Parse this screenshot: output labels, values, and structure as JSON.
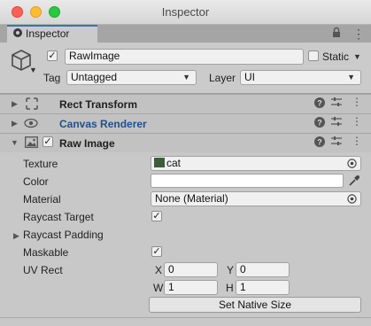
{
  "window": {
    "title": "Inspector"
  },
  "tab": {
    "label": "Inspector"
  },
  "gameobject": {
    "name": "RawImage",
    "static_label": "Static",
    "tag_label": "Tag",
    "tag_value": "Untagged",
    "layer_label": "Layer",
    "layer_value": "UI"
  },
  "components": [
    {
      "title": "Rect Transform"
    },
    {
      "title": "Canvas Renderer"
    },
    {
      "title": "Raw Image"
    }
  ],
  "raw_image": {
    "texture_label": "Texture",
    "texture_value": "cat",
    "color_label": "Color",
    "material_label": "Material",
    "material_value": "None (Material)",
    "raycast_target_label": "Raycast Target",
    "raycast_padding_label": "Raycast Padding",
    "maskable_label": "Maskable",
    "uv_rect_label": "UV Rect",
    "uv": {
      "x_label": "X",
      "x_value": "0",
      "y_label": "Y",
      "y_value": "0",
      "w_label": "W",
      "w_value": "1",
      "h_label": "H",
      "h_value": "1"
    },
    "native_size_button": "Set Native Size"
  },
  "colors": {
    "texture_swatch": "#3e5b3c",
    "canvas_renderer_title": "#1f4f8f"
  }
}
